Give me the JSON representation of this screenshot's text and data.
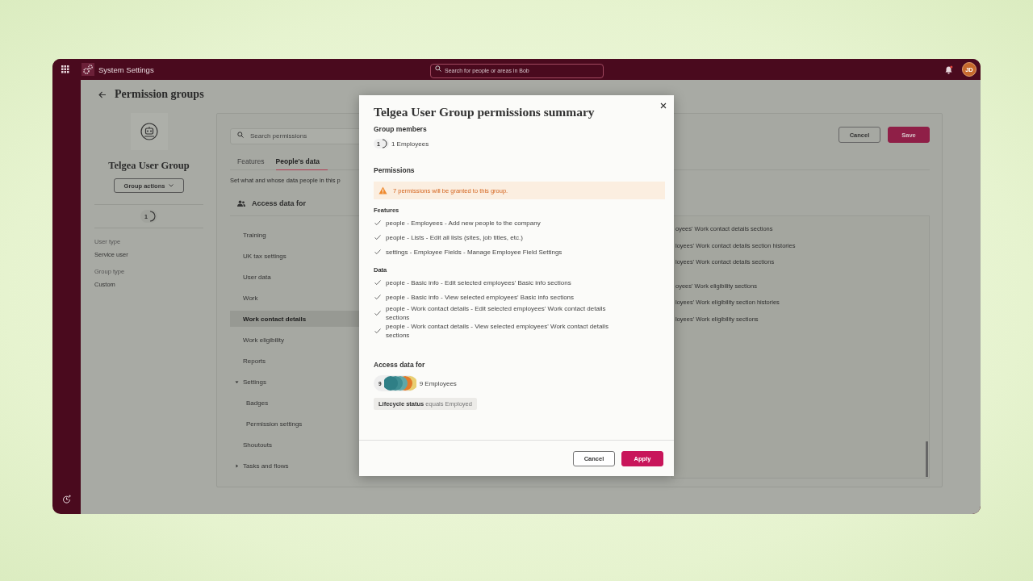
{
  "top_bar": {
    "app_title": "System Settings",
    "search": {
      "placeholder": "Search for people or areas in Bob"
    },
    "notifications": {
      "unread": true
    },
    "avatar": {
      "initials": "JD"
    }
  },
  "page": {
    "title": "Permission groups"
  },
  "group": {
    "name": "Telgea User Group",
    "actions_button": "Group actions",
    "members_count": "1",
    "details": [
      {
        "label": "User type",
        "value": "Service user"
      },
      {
        "label": "Group type",
        "value": "Custom"
      }
    ]
  },
  "panel": {
    "search": {
      "placeholder": "Search permissions"
    },
    "tabs": [
      {
        "label": "Features",
        "selected": false
      },
      {
        "label": "People's data",
        "selected": true
      }
    ],
    "description": "Set what and whose data people in this p",
    "buttons": [
      {
        "label": "Cancel",
        "kind": "secondary"
      },
      {
        "label": "Save",
        "kind": "primary"
      }
    ],
    "access_header": "Access data for",
    "tree": [
      {
        "label": "Training",
        "selected": false
      },
      {
        "label": "UK tax settings",
        "selected": false
      },
      {
        "label": "User data",
        "selected": false
      },
      {
        "label": "Work",
        "selected": false
      },
      {
        "label": "Work contact details",
        "selected": true
      },
      {
        "label": "Work eligibility",
        "selected": false
      },
      {
        "label": "Reports",
        "selected": false
      },
      {
        "label": "Settings",
        "selected": false,
        "expanded": true,
        "children": [
          {
            "label": "Badges",
            "selected": false
          },
          {
            "label": "Permission settings",
            "selected": false
          }
        ]
      },
      {
        "label": "Shoutouts",
        "selected": false
      },
      {
        "label": "Tasks and flows",
        "selected": false,
        "expanded": false
      }
    ],
    "permission_groups": [
      [
        "oyees' Work contact details sections",
        "loyees' Work contact details section histories",
        "loyees' Work contact details sections"
      ],
      [
        "oyees' Work eligibility sections",
        "loyees' Work eligibility section histories",
        "loyees' Work eligibility sections"
      ]
    ]
  },
  "modal": {
    "title": "Telgea User Group permissions summary",
    "members": {
      "heading": "Group members",
      "count": "1",
      "label": "1 Employees"
    },
    "permissions": {
      "heading": "Permissions",
      "warning": "7 permissions will be granted to this group.",
      "sections": [
        {
          "heading": "Features",
          "items": [
            "people - Employees - Add new people to the company",
            "people - Lists - Edit all lists (sites, job titles, etc.)",
            "settings - Employee Fields - Manage Employee Field Settings"
          ]
        },
        {
          "heading": "Data",
          "items": [
            "people - Basic info - Edit selected employees' Basic info sections",
            "people - Basic info - View selected employees' Basic info sections",
            "people - Work contact details - Edit selected employees' Work contact details sections",
            "people - Work contact details - View selected employees' Work contact details sections"
          ]
        }
      ]
    },
    "access": {
      "heading": "Access data for",
      "count": "9",
      "label": "9 Employees",
      "filter": "**Lifecycle status** equals Employed"
    },
    "buttons": [
      {
        "label": "Cancel",
        "kind": "secondary"
      },
      {
        "label": "Apply",
        "kind": "primary"
      }
    ]
  }
}
